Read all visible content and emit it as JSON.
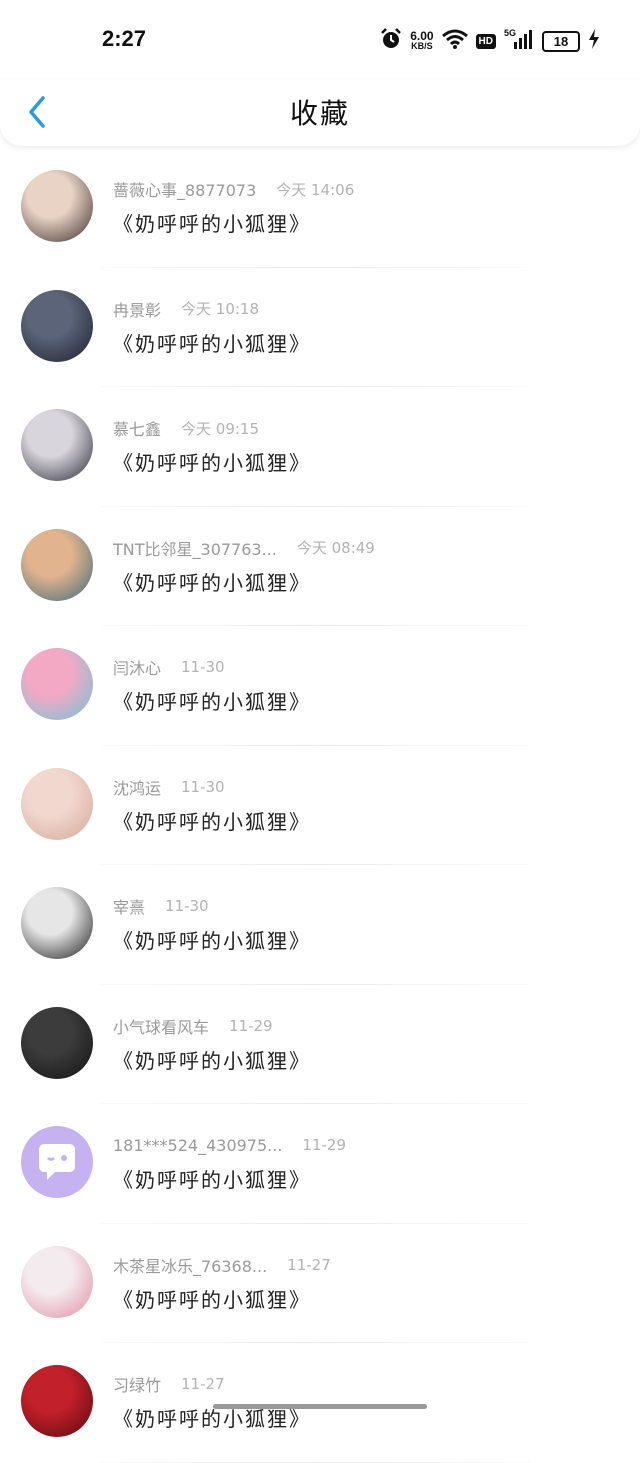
{
  "status": {
    "time": "2:27",
    "net_speed_value": "6.00",
    "net_speed_unit": "KB/S",
    "hd": "HD",
    "network": "5G",
    "battery": "18"
  },
  "header": {
    "title": "收藏"
  },
  "items": [
    {
      "name": "蔷薇心事_8877073",
      "time": "今天 14:06",
      "title": "《奶呼呼的小狐狸》",
      "avatar": "colorful-girl",
      "colors": [
        "#e8d3c4",
        "#3a2b2b"
      ]
    },
    {
      "name": "冉景彰",
      "time": "今天 10:18",
      "title": "《奶呼呼的小狐狸》",
      "avatar": "dark-portrait",
      "colors": [
        "#5b6478",
        "#1b1f2b"
      ]
    },
    {
      "name": "慕七鑫",
      "time": "今天 09:15",
      "title": "《奶呼呼的小狐狸》",
      "avatar": "boy-suit",
      "colors": [
        "#d8d5dc",
        "#2a2a35"
      ]
    },
    {
      "name": "TNT比邻星_307763...",
      "time": "今天 08:49",
      "title": "《奶呼呼的小狐狸》",
      "avatar": "orange-hair",
      "colors": [
        "#e2b38f",
        "#3d6b78"
      ]
    },
    {
      "name": "闫沐心",
      "time": "11-30",
      "title": "《奶呼呼的小狐狸》",
      "avatar": "anime-pink",
      "colors": [
        "#f3a9c4",
        "#6ec4d9"
      ]
    },
    {
      "name": "沈鸿运",
      "time": "11-30",
      "title": "《奶呼呼的小狐狸》",
      "avatar": "blonde-girl",
      "colors": [
        "#f2d7cf",
        "#d4a898"
      ]
    },
    {
      "name": "宰熹",
      "time": "11-30",
      "title": "《奶呼呼的小狐狸》",
      "avatar": "mono-portrait",
      "colors": [
        "#e6e6e6",
        "#1a1a1a"
      ]
    },
    {
      "name": "小气球看风车",
      "time": "11-29",
      "title": "《奶呼呼的小狐狸》",
      "avatar": "stage-night",
      "colors": [
        "#3c3c3c",
        "#121212"
      ]
    },
    {
      "name": "181***524_430975...",
      "time": "11-29",
      "title": "《奶呼呼的小狐狸》",
      "avatar": "chat-bubble",
      "colors": [
        "#c7b2f1",
        "#ffffff"
      ]
    },
    {
      "name": "木茶星冰乐_76368...",
      "time": "11-27",
      "title": "《奶呼呼的小狐狸》",
      "avatar": "anime-white",
      "colors": [
        "#f4ebef",
        "#e08ea0"
      ]
    },
    {
      "name": "习绿竹",
      "time": "11-27",
      "title": "《奶呼呼的小狐狸》",
      "avatar": "red-rose",
      "colors": [
        "#c2202a",
        "#5a0a10"
      ]
    }
  ]
}
